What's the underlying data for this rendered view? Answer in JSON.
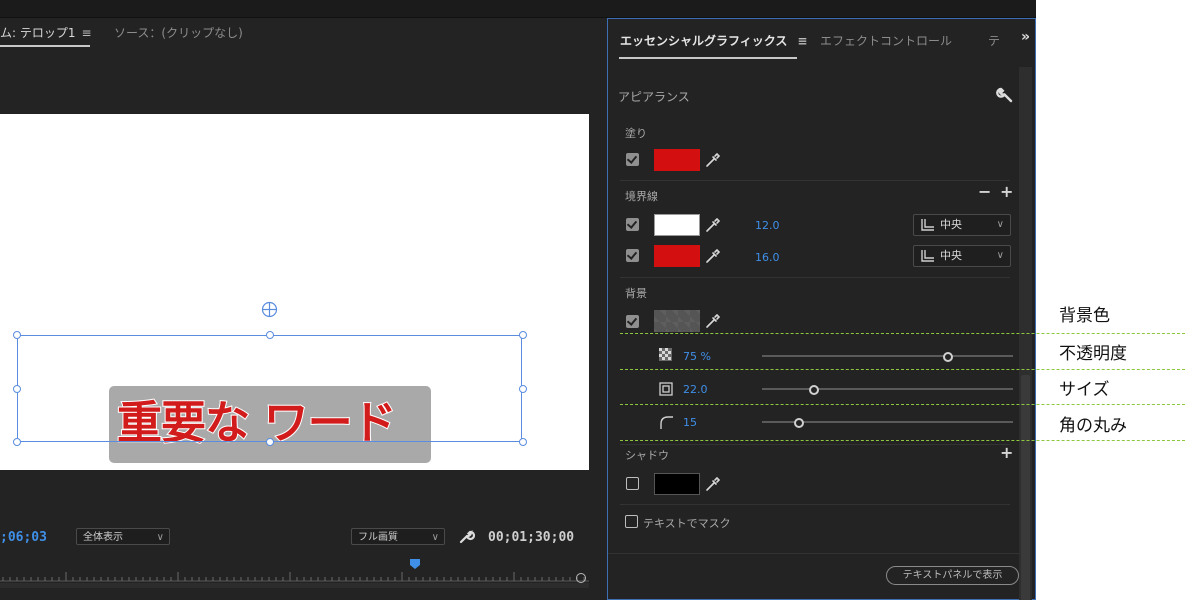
{
  "program_monitor": {
    "tab_active": "ム: テロップ1",
    "tab_source": "ソース：(クリップなし)",
    "title_text": "重要な ワード",
    "timecode_current": ";06;03",
    "zoom_select": "全体表示",
    "quality_select": "フル画質",
    "timecode_duration": "00;01;30;00"
  },
  "panel": {
    "tab_active": "エッセンシャルグラフィックス",
    "tab_effect": "エフェクトコントロール",
    "tab_third": "テ",
    "more": "»",
    "appearance_label": "アピアランス",
    "fill": {
      "label": "塗り",
      "color": "#d40f0f",
      "checked": true
    },
    "stroke": {
      "label": "境界線",
      "items": [
        {
          "color": "#ffffff",
          "width": "12.0",
          "position": "中央",
          "checked": true
        },
        {
          "color": "#d40f0f",
          "width": "16.0",
          "position": "中央",
          "checked": true
        }
      ]
    },
    "background": {
      "label": "背景",
      "color": "#555555",
      "checked": true,
      "opacity": "75 %",
      "opacity_value": 0.75,
      "size": "22.0",
      "size_value": 22,
      "corner_radius": "15",
      "corner_radius_value": 15
    },
    "shadow": {
      "label": "シャドウ",
      "color": "#000000",
      "checked": false
    },
    "mask_with_text": "テキストでマスク",
    "show_in_text_panel": "テキストパネルで表示"
  },
  "annotations": {
    "bg_color": "背景色",
    "opacity": "不透明度",
    "size": "サイズ",
    "corner_radius": "角の丸み"
  },
  "colors": {
    "accent_blue": "#3f8fe8",
    "annotation_dash": "#8dc63f"
  }
}
